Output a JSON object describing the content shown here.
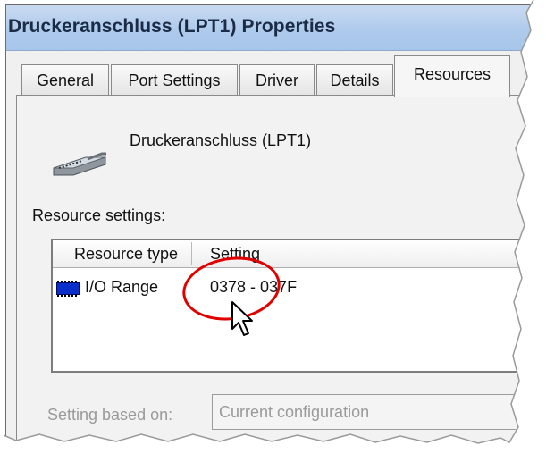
{
  "window": {
    "title": "Druckeranschluss (LPT1) Properties"
  },
  "tabs": [
    {
      "label": "General",
      "active": false
    },
    {
      "label": "Port Settings",
      "active": false
    },
    {
      "label": "Driver",
      "active": false
    },
    {
      "label": "Details",
      "active": false
    },
    {
      "label": "Resources",
      "active": true
    }
  ],
  "device": {
    "name": "Druckeranschluss (LPT1)",
    "icon": "printer-port-icon"
  },
  "resources": {
    "label": "Resource settings:",
    "columns": [
      "Resource type",
      "Setting"
    ],
    "rows": [
      {
        "type": "I/O Range",
        "setting": "0378 - 037F",
        "icon": "chip-icon"
      }
    ]
  },
  "setting_based_on": {
    "label": "Setting based on:",
    "value": "Current configuration"
  },
  "annotation": {
    "highlight_color": "#e00000"
  }
}
